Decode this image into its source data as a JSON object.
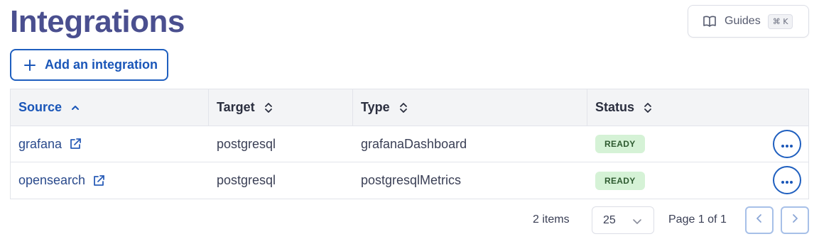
{
  "header": {
    "title": "Integrations",
    "guides_label": "Guides",
    "guides_shortcut": "⌘ K",
    "add_button_label": "Add an integration"
  },
  "table": {
    "columns": [
      {
        "label": "Source",
        "sort": "ascending"
      },
      {
        "label": "Target",
        "sort": "none"
      },
      {
        "label": "Type",
        "sort": "none"
      },
      {
        "label": "Status",
        "sort": "none"
      }
    ],
    "rows": [
      {
        "source": "grafana",
        "target": "postgresql",
        "type": "grafanaDashboard",
        "status": "READY"
      },
      {
        "source": "opensearch",
        "target": "postgresql",
        "type": "postgresqlMetrics",
        "status": "READY"
      }
    ]
  },
  "pagination": {
    "item_count": "2 items",
    "page_size": "25",
    "page_info": "Page 1 of 1"
  },
  "colors": {
    "title": "#4a4f8f",
    "accent": "#1a56b8",
    "ready_badge_bg": "#d5f2d6",
    "ready_badge_text": "#2e5a30"
  }
}
